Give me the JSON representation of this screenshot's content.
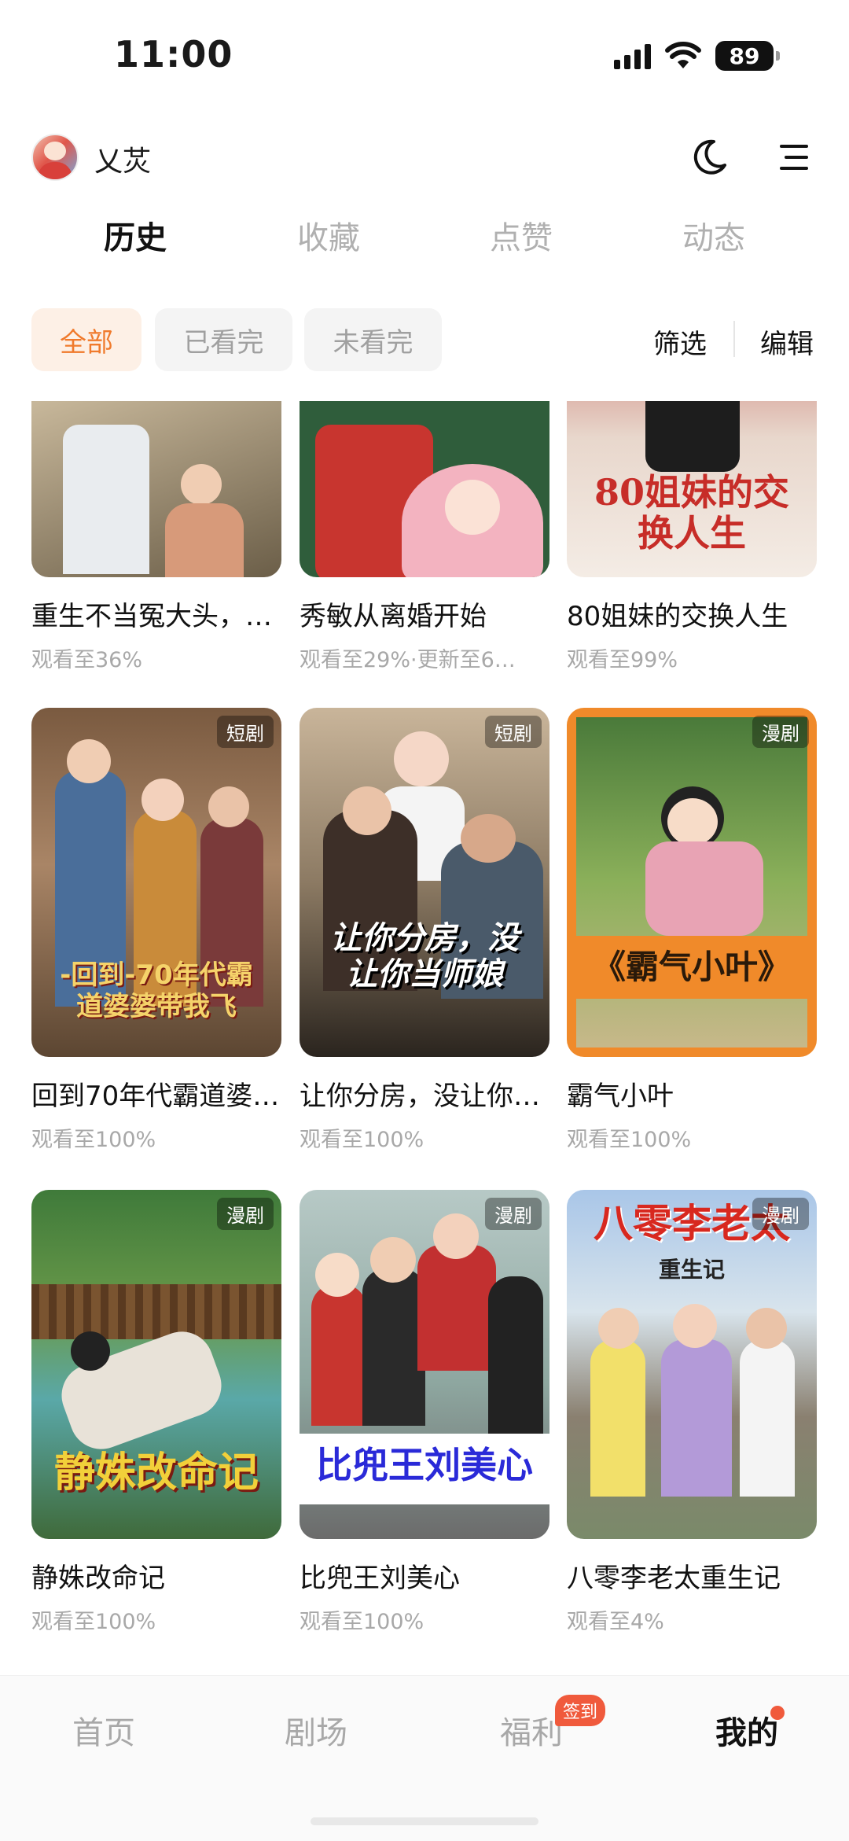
{
  "status": {
    "time": "11:00",
    "battery": "89"
  },
  "header": {
    "username": "乂炗"
  },
  "tabs": [
    "历史",
    "收藏",
    "点赞",
    "动态"
  ],
  "filters": {
    "all": "全部",
    "watched": "已看完",
    "unwatched": "未看完",
    "filter": "筛选",
    "edit": "编辑"
  },
  "items": [
    {
      "title": "重生不当冤大头，…",
      "sub": "观看至36%",
      "tag": ""
    },
    {
      "title": "秀敏从离婚开始",
      "sub": "观看至29%·更新至6…",
      "tag": ""
    },
    {
      "title": "80姐妹的交换人生",
      "sub": "观看至99%",
      "tag": "",
      "poster_text": "80姐妹的交换人生"
    },
    {
      "title": "回到70年代霸道婆…",
      "sub": "观看至100%",
      "tag": "短剧",
      "poster_text": "-回到-70年代霸道婆婆带我飞"
    },
    {
      "title": "让你分房，没让你…",
      "sub": "观看至100%",
      "tag": "短剧",
      "poster_text": "让你分房，没让你当师娘"
    },
    {
      "title": "霸气小叶",
      "sub": "观看至100%",
      "tag": "漫剧",
      "poster_text": "《霸气小叶》"
    },
    {
      "title": "静姝改命记",
      "sub": "观看至100%",
      "tag": "漫剧",
      "poster_text": "静姝改命记"
    },
    {
      "title": "比兜王刘美心",
      "sub": "观看至100%",
      "tag": "漫剧",
      "poster_text": "比兜王刘美心"
    },
    {
      "title": "八零李老太重生记",
      "sub": "观看至4%",
      "tag": "漫剧",
      "poster_text": "八零李老太",
      "poster_sub": "重生记"
    }
  ],
  "nav": {
    "home": "首页",
    "theater": "剧场",
    "welfare": "福利",
    "welfare_badge": "签到",
    "mine": "我的"
  }
}
